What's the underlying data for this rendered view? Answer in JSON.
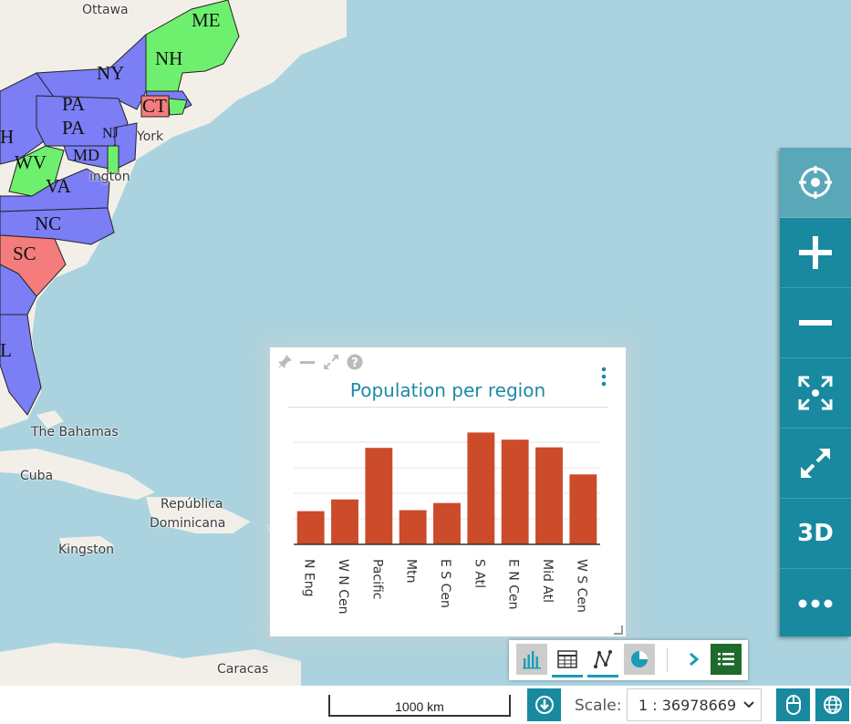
{
  "map": {
    "places": [
      "Ottawa",
      "York",
      "ington",
      "The Bahamas",
      "Cuba",
      "República",
      "Dominicana",
      "Kingston",
      "Caracas"
    ],
    "states": [
      "ME",
      "NH",
      "NY",
      "PA",
      "PA",
      "CT",
      "NJ",
      "WV",
      "MD",
      "VA",
      "NC",
      "SC",
      "H",
      "L"
    ],
    "colors": {
      "water": "#aad3df",
      "land": "#f2efe9",
      "blue": "#7b7ef5",
      "green": "#6ef06e",
      "red": "#f47c7c"
    }
  },
  "navbar": {
    "buttons": [
      "locate-icon",
      "zoom-in-icon",
      "zoom-out-icon",
      "full-extent-icon",
      "fullscreen-icon",
      "3D",
      "more-icon"
    ],
    "label_3d": "3D"
  },
  "widget": {
    "title": "Population per region",
    "tools": [
      "pin-icon",
      "minimize-icon",
      "expand-icon",
      "help-icon"
    ],
    "menu_icon": "vertical-dots-icon"
  },
  "chart_data": {
    "type": "bar",
    "title": "Population per region",
    "categories": [
      "N Eng",
      "W N Cen",
      "Pacific",
      "Mtn",
      "E S Cen",
      "S Atl",
      "E N Cen",
      "Mid Atl",
      "W S Cen"
    ],
    "values": [
      13,
      17.6,
      37.8,
      13.4,
      16.2,
      43.8,
      41,
      38,
      27.4
    ],
    "ylim": [
      0,
      50
    ],
    "grid": true,
    "color": "#cc4b2a"
  },
  "modebar": {
    "buttons": [
      "bar-chart-icon",
      "table-icon",
      "line-chart-icon",
      "pie-chart-icon",
      "chevron-right-icon",
      "list-icon"
    ]
  },
  "bottombar": {
    "scalebar_label": "1000 km",
    "scale_label": "Scale:",
    "scale_value": "1 : 36978669"
  }
}
